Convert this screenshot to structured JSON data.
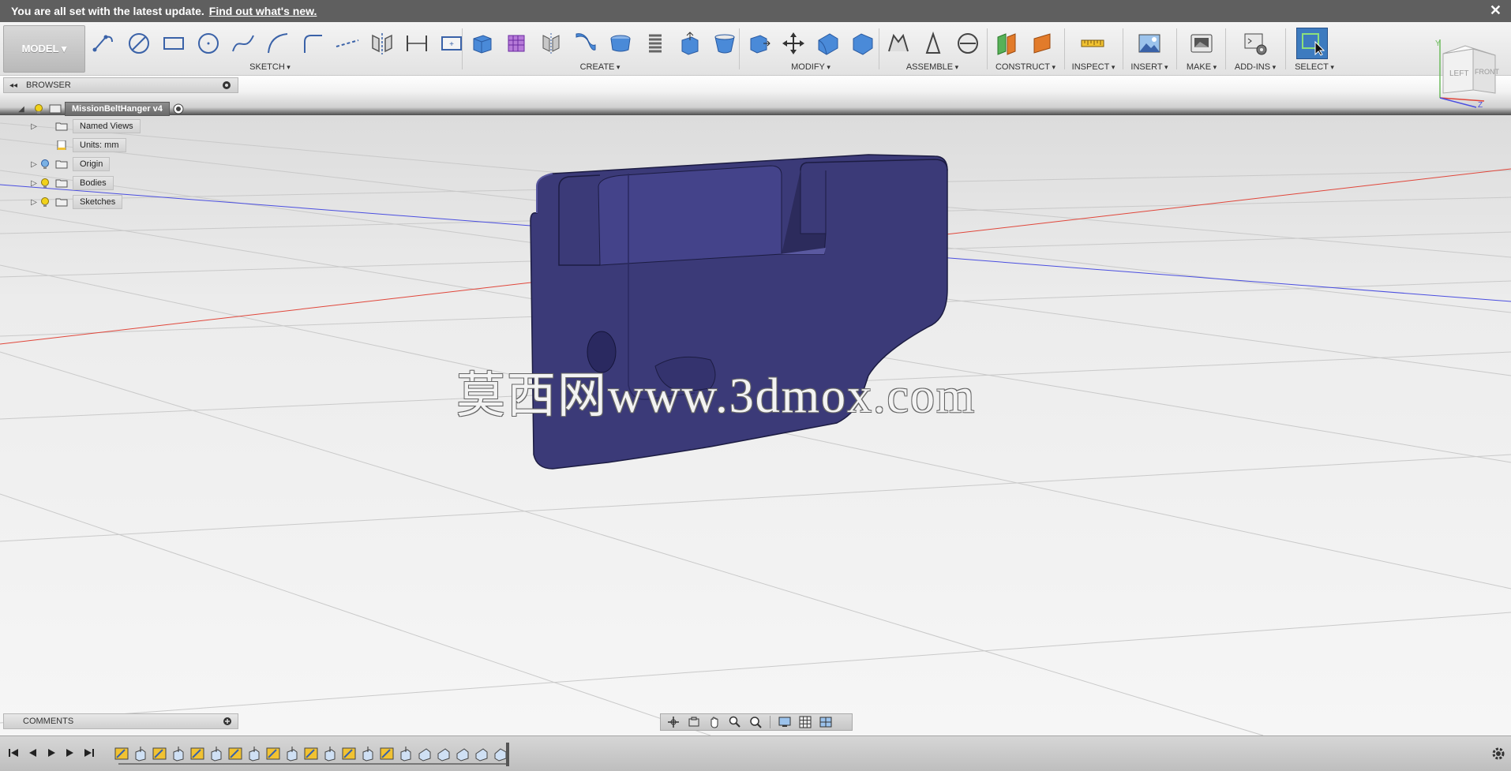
{
  "notification": {
    "message": "You are all set with the latest update.",
    "link": "Find out what's new.",
    "close_glyph": "✕"
  },
  "toolbar": {
    "workspace_label": "MODEL ▾",
    "groups": {
      "sketch": "SKETCH",
      "create": "CREATE",
      "modify": "MODIFY",
      "assemble": "ASSEMBLE",
      "construct": "CONSTRUCT",
      "inspect": "INSPECT",
      "insert": "INSERT",
      "make": "MAKE",
      "addins": "ADD-INS",
      "select": "SELECT"
    }
  },
  "browser": {
    "title": "BROWSER",
    "collapse_glyph": "◂◂",
    "root": "MissionBeltHanger v4",
    "items": [
      {
        "label": "Named Views",
        "icon": "folder-icon",
        "expandable": true,
        "bulb": false
      },
      {
        "label": "Units: mm",
        "icon": "document-icon",
        "expandable": false,
        "bulb": false
      },
      {
        "label": "Origin",
        "icon": "folder-icon",
        "expandable": true,
        "bulb": true,
        "bulb_color": "#7ab1e4"
      },
      {
        "label": "Bodies",
        "icon": "folder-icon",
        "expandable": true,
        "bulb": true,
        "bulb_color": "#f1d21b"
      },
      {
        "label": "Sketches",
        "icon": "folder-icon",
        "expandable": true,
        "bulb": true,
        "bulb_color": "#f1d21b"
      }
    ]
  },
  "comments": {
    "title": "COMMENTS"
  },
  "viewcube": {
    "left": "LEFT",
    "front": "FRONT",
    "axis_y": "Y",
    "axis_z": "Z"
  },
  "watermark": "莫西网www.3dmox.com",
  "colors": {
    "model_body": "#3b3a78",
    "x_axis": "#e0463a",
    "z_axis": "#4a4ee0",
    "select_accent": "#3d7bbf"
  }
}
